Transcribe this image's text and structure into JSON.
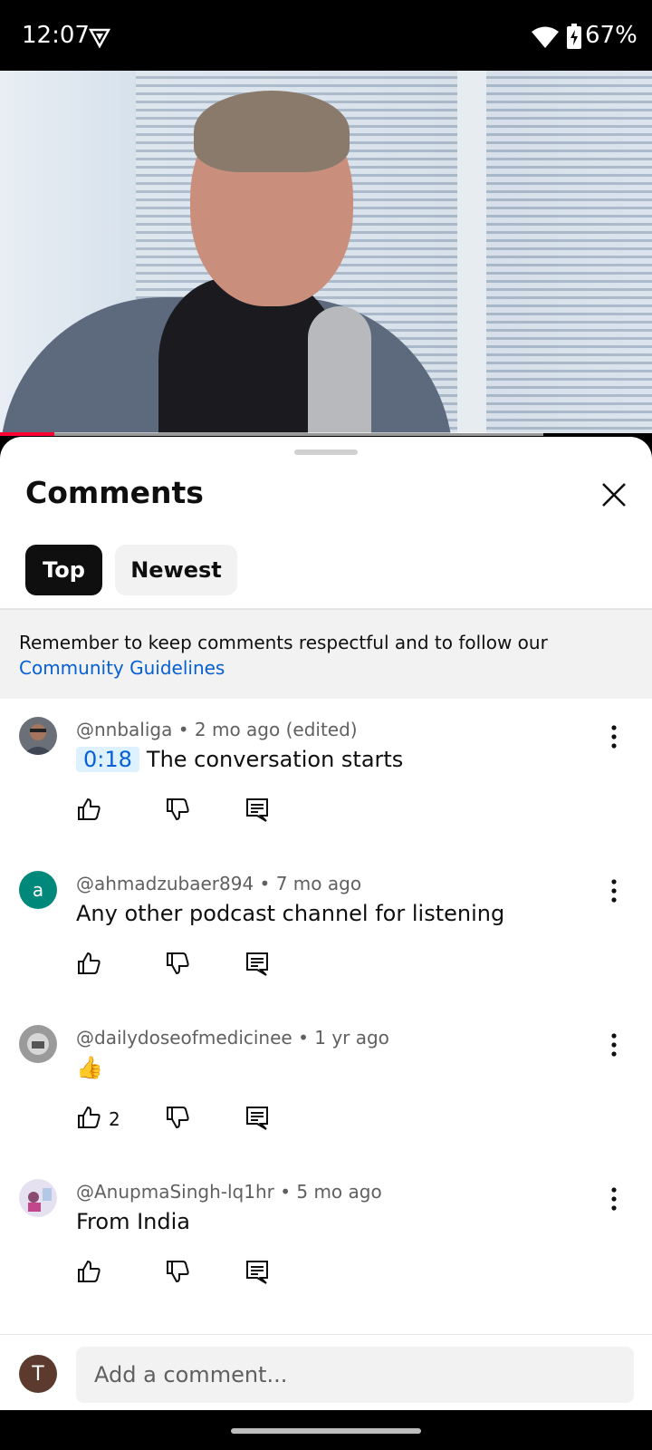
{
  "status_bar": {
    "time": "12:07",
    "battery": "67%",
    "icons": [
      "vpn-shield-icon",
      "wifi-icon",
      "battery-charging-icon"
    ]
  },
  "video": {
    "progress": 0.1
  },
  "sheet": {
    "title": "Comments",
    "close_icon": "close-icon",
    "sort_chips": [
      {
        "label": "Top",
        "selected": true
      },
      {
        "label": "Newest",
        "selected": false
      }
    ],
    "notice": {
      "text": "Remember to keep comments respectful and to follow our",
      "link": "Community Guidelines"
    }
  },
  "comments": [
    {
      "author": "@nnbaliga",
      "meta": " • 2 mo ago (edited)",
      "timestamp": "0:18",
      "text": "The conversation starts",
      "likes": "",
      "avatar": "photo"
    },
    {
      "author": "@ahmadzubaer894",
      "meta": " • 7 mo ago",
      "timestamp": "",
      "text": "Any other podcast channel for listening",
      "likes": "",
      "avatar": "a"
    },
    {
      "author": "@dailydoseofmedicinee",
      "meta": " • 1 yr ago",
      "timestamp": "",
      "text": "👍",
      "likes": "2",
      "avatar": "photo"
    },
    {
      "author": "@AnupmaSingh-lq1hr",
      "meta": " • 5 mo ago",
      "timestamp": "",
      "text": "From India",
      "likes": "",
      "avatar": "photo"
    }
  ],
  "input": {
    "avatar_letter": "T",
    "placeholder": "Add a comment..."
  },
  "colors": {
    "accent_blue": "#065fd4",
    "progress_red": "#ff0033",
    "chip_selected": "#0f0f0f",
    "chip_unselected": "#f2f2f2"
  }
}
